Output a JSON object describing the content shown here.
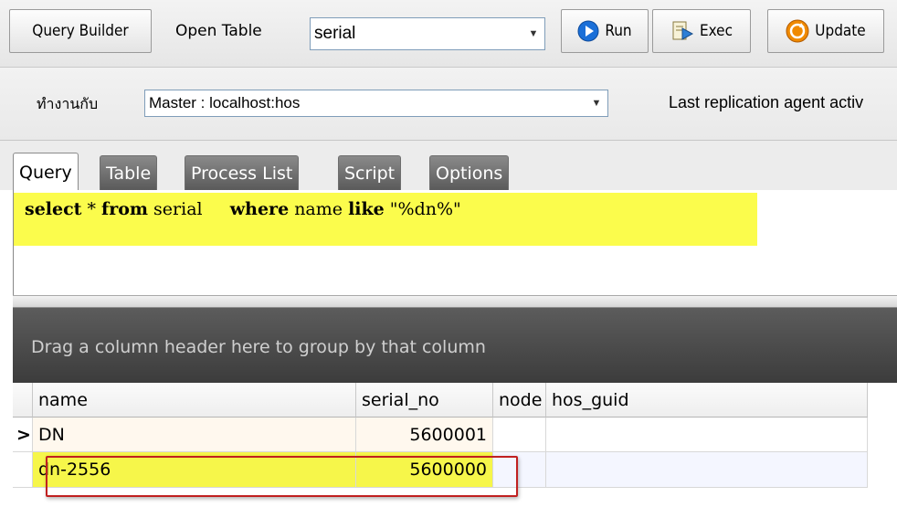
{
  "toolbar": {
    "query_builder_label": "Query Builder",
    "open_table_label": "Open Table",
    "table_select": {
      "value": "serial"
    },
    "run_label": "Run",
    "exec_label": "Exec",
    "update_label": "Update"
  },
  "connection": {
    "label": "ทำงานกับ",
    "value": "Master : localhost:hos",
    "replication_text": "Last replication agent activ"
  },
  "tabs": [
    {
      "label": "Query",
      "active": true
    },
    {
      "label": "Table",
      "active": false
    },
    {
      "label": "Process List",
      "active": false
    },
    {
      "label": "Script",
      "active": false
    },
    {
      "label": "Options",
      "active": false
    }
  ],
  "editor": {
    "kw_select": "select",
    "star": " * ",
    "kw_from": "from",
    "table": " serial     ",
    "kw_where": "where",
    "col": " name ",
    "kw_like": "like",
    "pattern": " \"%dn%\""
  },
  "grid": {
    "group_hint": "Drag a column header here to group by that column",
    "columns": [
      "name",
      "serial_no",
      "node",
      "hos_guid"
    ],
    "row_indicator": ">",
    "rows": [
      {
        "name": "DN",
        "serial_no": "5600001",
        "node": "",
        "hos_guid": ""
      },
      {
        "name": "dn-2556",
        "serial_no": "5600000",
        "node": "",
        "hos_guid": ""
      }
    ]
  },
  "colors": {
    "highlight": "#fbfc4c",
    "annotation_box": "#c02020",
    "run_icon": "#1a6fd8",
    "update_icon": "#f08a00"
  }
}
